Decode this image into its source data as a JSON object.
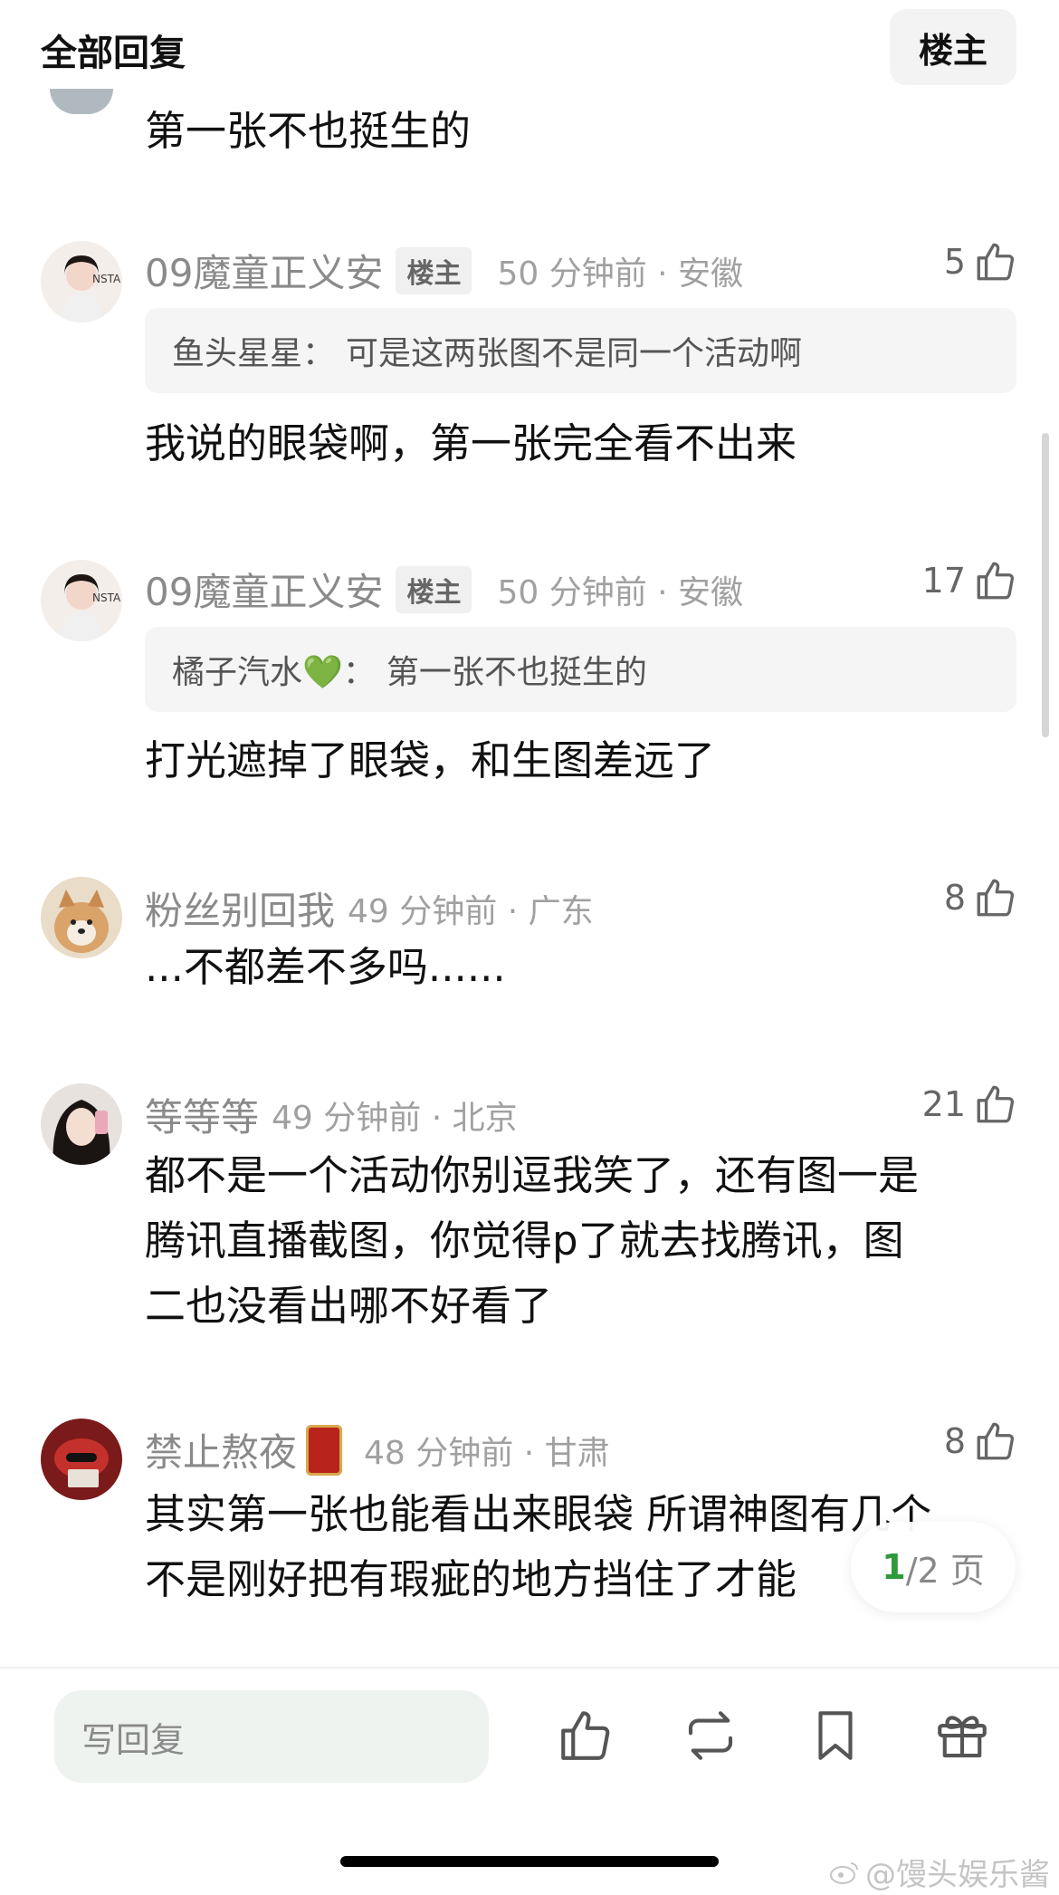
{
  "header": {
    "title": "全部回复",
    "owner_toggle": "楼主"
  },
  "top_comment": {
    "text": "第一张不也挺生的"
  },
  "comments": [
    {
      "name": "09魔童正义安",
      "owner_badge": "楼主",
      "time": "50 分钟前 · 安徽",
      "likes": "5",
      "quote_user": "鱼头星星：",
      "quote_text": "可是这两张图不是同一个活动啊",
      "text": "我说的眼袋啊，第一张完全看不出来"
    },
    {
      "name": "09魔童正义安",
      "owner_badge": "楼主",
      "time": "50 分钟前 · 安徽",
      "likes": "17",
      "quote_user": "橘子汽水💚：",
      "quote_text": "第一张不也挺生的",
      "text": "打光遮掉了眼袋，和生图差远了"
    },
    {
      "name": "粉丝别回我",
      "time": "49 分钟前 · 广东",
      "likes": "8",
      "text": "...不都差不多吗......"
    },
    {
      "name": "等等等",
      "time": "49 分钟前 · 北京",
      "likes": "21",
      "text_lines": [
        "都不是一个活动你别逗我笑了，还有图一是",
        "腾讯直播截图，你觉得p了就去找腾讯，图",
        "二也没看出哪不好看了"
      ]
    },
    {
      "name": "禁止熬夜",
      "time": "48 分钟前 · 甘肃",
      "likes": "8",
      "text_lines": [
        "其实第一张也能看出来眼袋 所谓神图有几个",
        "不是刚好把有瑕疵的地方挡住了才能"
      ]
    }
  ],
  "pagination": {
    "current": "1",
    "total": "/2 页"
  },
  "footer": {
    "reply_placeholder": "写回复"
  },
  "watermark": "@馒头娱乐酱",
  "colors": {
    "accent_green": "#2e9a3a",
    "reply_box_bg": "#eef3ef",
    "badge_bg": "#f0f0f0"
  },
  "icons": [
    "thumb-up-icon",
    "repost-icon",
    "bookmark-icon",
    "gift-icon",
    "weibo-icon"
  ]
}
